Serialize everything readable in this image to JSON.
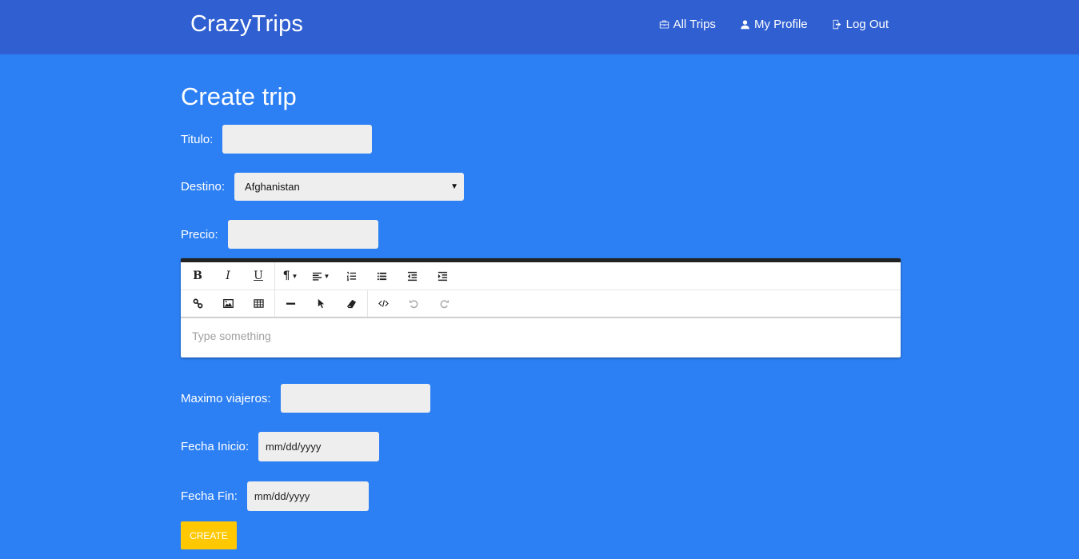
{
  "navbar": {
    "brand": "CrazyTrips",
    "links": [
      {
        "label": "All Trips",
        "icon": "briefcase-icon"
      },
      {
        "label": "My Profile",
        "icon": "user-icon"
      },
      {
        "label": "Log Out",
        "icon": "logout-icon"
      }
    ]
  },
  "page": {
    "title": "Create trip"
  },
  "form": {
    "titulo_label": "Titulo:",
    "titulo_value": "",
    "destino_label": "Destino:",
    "destino_value": "Afghanistan",
    "precio_label": "Precio:",
    "precio_value": "",
    "editor_placeholder": "Type something",
    "maximo_label": "Maximo viajeros:",
    "maximo_value": "",
    "fecha_inicio_label": "Fecha Inicio:",
    "fecha_inicio_placeholder": "mm/dd/yyyy",
    "fecha_fin_label": "Fecha Fin:",
    "fecha_fin_placeholder": "mm/dd/yyyy",
    "submit_label": "CREATE"
  },
  "editor_toolbar": {
    "row1": [
      "bold",
      "italic",
      "underline",
      "paragraph-style",
      "align",
      "ordered-list",
      "unordered-list",
      "outdent",
      "indent"
    ],
    "row2": [
      "link",
      "image",
      "table",
      "horizontal-rule",
      "select",
      "eraser",
      "code-view",
      "undo",
      "redo"
    ],
    "bold_glyph": "B",
    "italic_glyph": "I",
    "underline_glyph": "U",
    "paragraph_glyph": "¶"
  },
  "colors": {
    "navbar": "#2f5fd1",
    "background": "#2d80f4",
    "button": "#ffc800",
    "input": "#eeeeee"
  }
}
